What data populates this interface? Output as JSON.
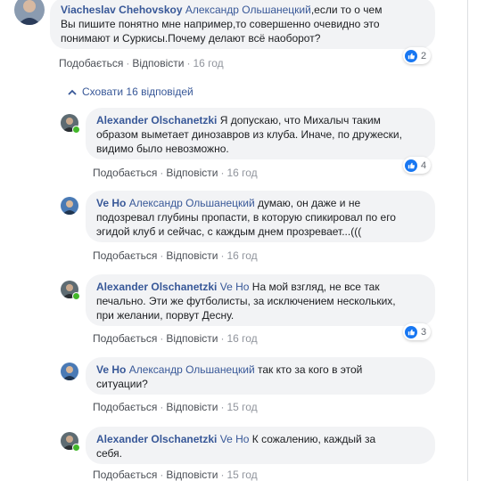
{
  "colors": {
    "link": "#385898",
    "bubble": "#f2f3f5",
    "like": "#1877f2",
    "online": "#42b72a"
  },
  "actions": {
    "like": "Подобається",
    "reply": "Відповісти",
    "sep": "·"
  },
  "hide_replies": {
    "icon": "chevron-up-icon",
    "label": "Сховати 16 відповідей"
  },
  "comments": [
    {
      "author": "Viacheslav Chehovskoy",
      "mention": "Александр Ольшанецкий",
      "text_lines": [
        ",если то о чем",
        "Вы пишите понятно мне например,то совершенно очевидно это",
        "понимают и Суркисы.Почему делают всё наоборот?"
      ],
      "time": "16 год",
      "reactions": "2"
    },
    {
      "author": "Alexander Olschanetzki",
      "mention": "",
      "text_lines": [
        " Я допускаю, что Михалыч таким",
        "образом выметает динозавров из клуба. Иначе, по дружески,",
        "видимо было невозможно."
      ],
      "time": "16 год",
      "reactions": "4"
    },
    {
      "author": "Ve Ho",
      "mention": "Александр Ольшанецкий",
      "text_lines": [
        " думаю, он даже и не",
        "подозревал глубины пропасти, в которую спикировал по его",
        "эгидой клуб и сейчас, с каждым днем прозревает...((("
      ],
      "time": "16 год",
      "reactions": ""
    },
    {
      "author": "Alexander Olschanetzki",
      "mention": "Ve Ho",
      "text_lines": [
        " На мой взгляд, не все так",
        "печально. Эти же футболисты, за исключением нескольких,",
        "при желании, порвут Десну."
      ],
      "time": "16 год",
      "reactions": "3"
    },
    {
      "author": "Ve Ho",
      "mention": "Александр Ольшанецкий",
      "text_lines": [
        " так кто за кого в этой",
        "ситуации?"
      ],
      "time": "15 год",
      "reactions": ""
    },
    {
      "author": "Alexander Olschanetzki",
      "mention": "Ve Ho",
      "text_lines": [
        " К сожалению, каждый за",
        "себя."
      ],
      "time": "15 год",
      "reactions": ""
    }
  ]
}
